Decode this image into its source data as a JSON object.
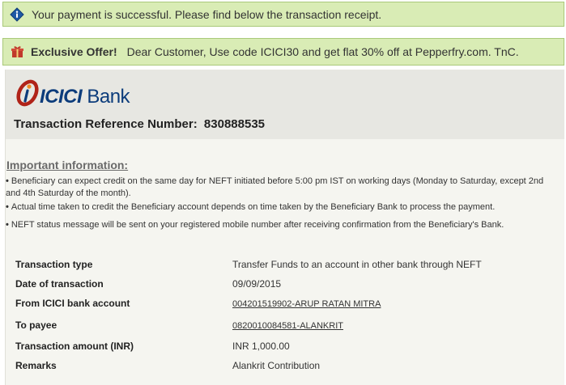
{
  "success_banner": {
    "message": "Your payment is successful. Please find below the transaction receipt."
  },
  "offer_banner": {
    "title": "Exclusive Offer!",
    "message": "Dear Customer, Use code ICICI30 and get flat 30% off at Pepperfry.com. TnC."
  },
  "receipt": {
    "logo_text_bold": "ICICI",
    "logo_text": "Bank",
    "reference_label": "Transaction Reference Number:",
    "reference_number": "830888535",
    "important_title": "Important information:",
    "notes": [
      "Beneficiary can expect credit on the same day for NEFT initiated before 5:00 pm IST on working days (Monday to Saturday, except 2nd and 4th Saturday of the month).",
      "Actual time taken to credit the Beneficiary account depends on time taken by the Beneficiary Bank to process the payment.",
      "NEFT status message will be sent on your registered mobile number after receiving confirmation from the Beneficiary's Bank."
    ],
    "details": [
      {
        "label": "Transaction type",
        "value": "Transfer Funds to an account in other bank through NEFT"
      },
      {
        "label": "Date of transaction",
        "value": "09/09/2015"
      },
      {
        "label": "From ICICI bank account",
        "value": "004201519902-ARUP RATAN MITRA"
      },
      {
        "label": "To payee",
        "value": "0820010084581-ALANKRIT"
      },
      {
        "label": "Transaction amount (INR)",
        "value": "INR 1,000.00"
      },
      {
        "label": "Remarks",
        "value": "Alankrit Contribution"
      }
    ]
  },
  "colors": {
    "banner_bg": "#d9ecb5",
    "brand_red": "#b02318",
    "brand_blue": "#0c3c7b",
    "gift_red": "#c0392b"
  }
}
